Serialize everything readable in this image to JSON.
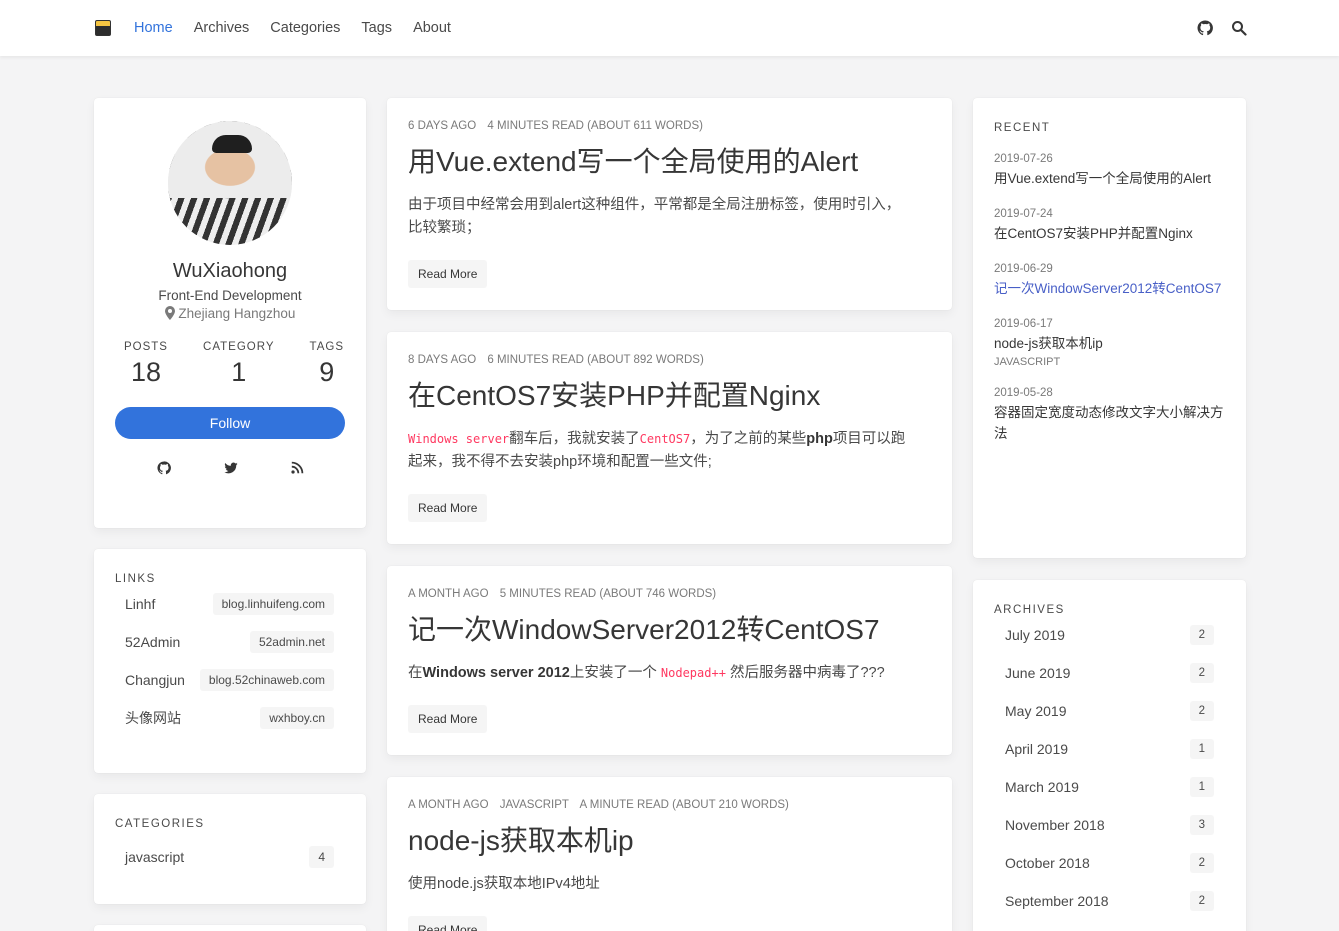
{
  "nav": {
    "items": [
      "Home",
      "Archives",
      "Categories",
      "Tags",
      "About"
    ],
    "active": "Home"
  },
  "profile": {
    "name": "WuXiaohong",
    "role": "Front-End Development",
    "location": "Zhejiang Hangzhou",
    "stats": [
      {
        "label": "POSTS",
        "value": "18"
      },
      {
        "label": "CATEGORY",
        "value": "1"
      },
      {
        "label": "TAGS",
        "value": "9"
      }
    ],
    "follow_label": "Follow"
  },
  "links": {
    "title": "LINKS",
    "items": [
      {
        "name": "Linhf",
        "url": "blog.linhuifeng.com"
      },
      {
        "name": "52Admin",
        "url": "52admin.net"
      },
      {
        "name": "Changjun",
        "url": "blog.52chinaweb.com"
      },
      {
        "name": "头像网站",
        "url": "wxhboy.cn"
      }
    ]
  },
  "categories": {
    "title": "CATEGORIES",
    "items": [
      {
        "name": "javascript",
        "count": "4"
      }
    ]
  },
  "posts": [
    {
      "date": "6 DAYS AGO",
      "category": "",
      "read": "4 MINUTES READ (ABOUT 611 WORDS)",
      "title": "用Vue.extend写一个全局使用的Alert",
      "excerpt": "由于项目中经常会用到alert这种组件，平常都是全局注册标签，使用时引入，比较繁琐；",
      "readmore": "Read More"
    },
    {
      "date": "8 DAYS AGO",
      "category": "",
      "read": "6 MINUTES READ (ABOUT 892 WORDS)",
      "title": "在CentOS7安装PHP并配置Nginx",
      "excerpt_parts": {
        "code1": "Windows server",
        "t1": "翻车后，我就安装了",
        "code2": "CentOS7",
        "t2": "，为了之前的某些",
        "bold": "php",
        "t3": "项目可以跑起来，我不得不去安装php环境和配置一些文件;"
      },
      "readmore": "Read More"
    },
    {
      "date": "A MONTH AGO",
      "category": "",
      "read": "5 MINUTES READ (ABOUT 746 WORDS)",
      "title": "记一次WindowServer2012转CentOS7",
      "excerpt_parts": {
        "t1": "在",
        "bold": "Windows server 2012",
        "t2": "上安装了一个 ",
        "code": "Nodepad++",
        "t3": " 然后服务器中病毒了???"
      },
      "readmore": "Read More"
    },
    {
      "date": "A MONTH AGO",
      "category": "JAVASCRIPT",
      "read": "A MINUTE READ (ABOUT 210 WORDS)",
      "title": "node-js获取本机ip",
      "excerpt": "使用node.js获取本地IPv4地址",
      "readmore": "Read More"
    }
  ],
  "recent": {
    "title": "RECENT",
    "items": [
      {
        "date": "2019-07-26",
        "title": "用Vue.extend写一个全局使用的Alert",
        "category": ""
      },
      {
        "date": "2019-07-24",
        "title": "在CentOS7安装PHP并配置Nginx",
        "category": ""
      },
      {
        "date": "2019-06-29",
        "title": "记一次WindowServer2012转CentOS7",
        "category": ""
      },
      {
        "date": "2019-06-17",
        "title": "node-js获取本机ip",
        "category": "JAVASCRIPT"
      },
      {
        "date": "2019-05-28",
        "title": "容器固定宽度动态修改文字大小解决方法",
        "category": ""
      }
    ]
  },
  "archives": {
    "title": "ARCHIVES",
    "items": [
      {
        "month": "July 2019",
        "count": "2"
      },
      {
        "month": "June 2019",
        "count": "2"
      },
      {
        "month": "May 2019",
        "count": "2"
      },
      {
        "month": "April 2019",
        "count": "1"
      },
      {
        "month": "March 2019",
        "count": "1"
      },
      {
        "month": "November 2018",
        "count": "3"
      },
      {
        "month": "October 2018",
        "count": "2"
      },
      {
        "month": "September 2018",
        "count": "2"
      }
    ]
  },
  "colors": {
    "accent": "#3273dc",
    "code": "#ff3860",
    "link": "#485fc7"
  },
  "icons": [
    "github-icon",
    "search-icon",
    "map-marker-icon",
    "twitter-icon",
    "rss-icon"
  ]
}
